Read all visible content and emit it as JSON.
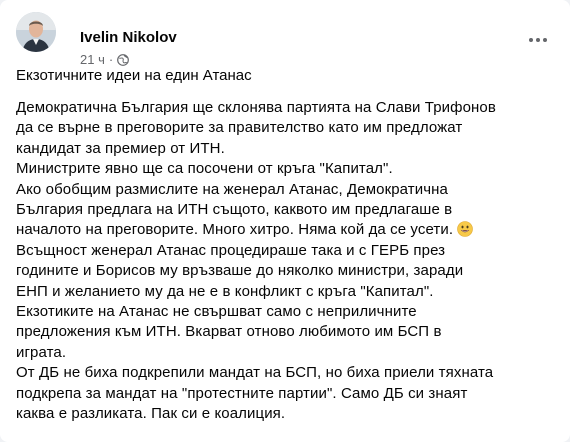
{
  "post": {
    "author": "Ivelin Nikolov",
    "time": "21 ч",
    "separator": "·",
    "title": "Екзотичните идеи на един Атанас",
    "paragraphs": [
      "Демократична България ще склонява партията на Слави Трифонов",
      "да се върне в преговорите за правителство като им предложат",
      "кандидат за премиер от ИТН.",
      "Министрите явно ще са посочени от кръга \"Капитал\".",
      "Ако обобщим размислите на женерал Атанас, Демократична",
      "България предлага на ИТН същото,  каквото им предлагаше в",
      "началото на преговорите. Много хитро. Няма кой да се усети.",
      "Всъщност женерал Атанас процедираше така и с ГЕРБ през",
      "годините и Борисов му връзваше до няколко министри, заради",
      "ЕНП и желанието му да не е в конфликт с кръга \"Капитал\".",
      "Екзотиките на Атанас не свършват само с неприличните",
      "предложения към ИТН. Вкарват отново любимото им БСП в",
      "играта.",
      "От ДБ не биха подкрепили мандат на БСП, но биха приели тяхната",
      "подкрепа за мандат на \"протестните партии\". Само ДБ си знаят",
      "каква е разликата. Пак си е коалиция."
    ]
  },
  "icons": {
    "audience": "globe-icon",
    "menu": "more-options-icon",
    "emoji": "smiley-emoji-icon"
  }
}
